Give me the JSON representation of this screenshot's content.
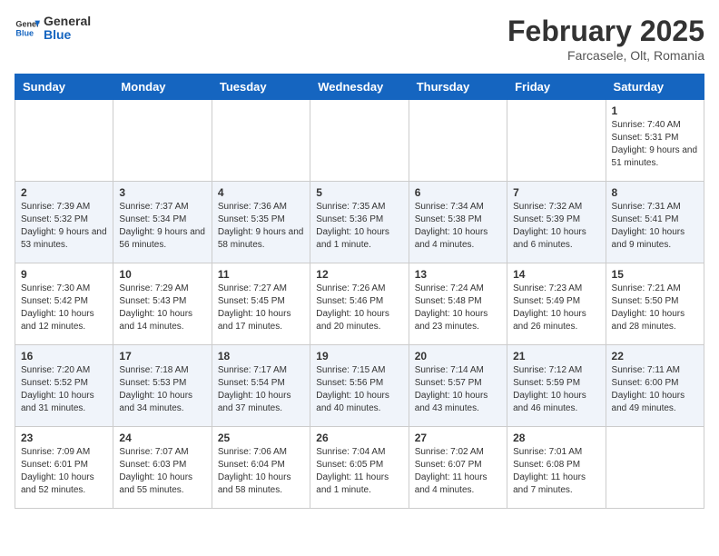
{
  "header": {
    "logo_line1": "General",
    "logo_line2": "Blue",
    "month": "February 2025",
    "location": "Farcasele, Olt, Romania"
  },
  "weekdays": [
    "Sunday",
    "Monday",
    "Tuesday",
    "Wednesday",
    "Thursday",
    "Friday",
    "Saturday"
  ],
  "weeks": [
    [
      {
        "day": "",
        "info": ""
      },
      {
        "day": "",
        "info": ""
      },
      {
        "day": "",
        "info": ""
      },
      {
        "day": "",
        "info": ""
      },
      {
        "day": "",
        "info": ""
      },
      {
        "day": "",
        "info": ""
      },
      {
        "day": "1",
        "info": "Sunrise: 7:40 AM\nSunset: 5:31 PM\nDaylight: 9 hours and 51 minutes."
      }
    ],
    [
      {
        "day": "2",
        "info": "Sunrise: 7:39 AM\nSunset: 5:32 PM\nDaylight: 9 hours and 53 minutes."
      },
      {
        "day": "3",
        "info": "Sunrise: 7:37 AM\nSunset: 5:34 PM\nDaylight: 9 hours and 56 minutes."
      },
      {
        "day": "4",
        "info": "Sunrise: 7:36 AM\nSunset: 5:35 PM\nDaylight: 9 hours and 58 minutes."
      },
      {
        "day": "5",
        "info": "Sunrise: 7:35 AM\nSunset: 5:36 PM\nDaylight: 10 hours and 1 minute."
      },
      {
        "day": "6",
        "info": "Sunrise: 7:34 AM\nSunset: 5:38 PM\nDaylight: 10 hours and 4 minutes."
      },
      {
        "day": "7",
        "info": "Sunrise: 7:32 AM\nSunset: 5:39 PM\nDaylight: 10 hours and 6 minutes."
      },
      {
        "day": "8",
        "info": "Sunrise: 7:31 AM\nSunset: 5:41 PM\nDaylight: 10 hours and 9 minutes."
      }
    ],
    [
      {
        "day": "9",
        "info": "Sunrise: 7:30 AM\nSunset: 5:42 PM\nDaylight: 10 hours and 12 minutes."
      },
      {
        "day": "10",
        "info": "Sunrise: 7:29 AM\nSunset: 5:43 PM\nDaylight: 10 hours and 14 minutes."
      },
      {
        "day": "11",
        "info": "Sunrise: 7:27 AM\nSunset: 5:45 PM\nDaylight: 10 hours and 17 minutes."
      },
      {
        "day": "12",
        "info": "Sunrise: 7:26 AM\nSunset: 5:46 PM\nDaylight: 10 hours and 20 minutes."
      },
      {
        "day": "13",
        "info": "Sunrise: 7:24 AM\nSunset: 5:48 PM\nDaylight: 10 hours and 23 minutes."
      },
      {
        "day": "14",
        "info": "Sunrise: 7:23 AM\nSunset: 5:49 PM\nDaylight: 10 hours and 26 minutes."
      },
      {
        "day": "15",
        "info": "Sunrise: 7:21 AM\nSunset: 5:50 PM\nDaylight: 10 hours and 28 minutes."
      }
    ],
    [
      {
        "day": "16",
        "info": "Sunrise: 7:20 AM\nSunset: 5:52 PM\nDaylight: 10 hours and 31 minutes."
      },
      {
        "day": "17",
        "info": "Sunrise: 7:18 AM\nSunset: 5:53 PM\nDaylight: 10 hours and 34 minutes."
      },
      {
        "day": "18",
        "info": "Sunrise: 7:17 AM\nSunset: 5:54 PM\nDaylight: 10 hours and 37 minutes."
      },
      {
        "day": "19",
        "info": "Sunrise: 7:15 AM\nSunset: 5:56 PM\nDaylight: 10 hours and 40 minutes."
      },
      {
        "day": "20",
        "info": "Sunrise: 7:14 AM\nSunset: 5:57 PM\nDaylight: 10 hours and 43 minutes."
      },
      {
        "day": "21",
        "info": "Sunrise: 7:12 AM\nSunset: 5:59 PM\nDaylight: 10 hours and 46 minutes."
      },
      {
        "day": "22",
        "info": "Sunrise: 7:11 AM\nSunset: 6:00 PM\nDaylight: 10 hours and 49 minutes."
      }
    ],
    [
      {
        "day": "23",
        "info": "Sunrise: 7:09 AM\nSunset: 6:01 PM\nDaylight: 10 hours and 52 minutes."
      },
      {
        "day": "24",
        "info": "Sunrise: 7:07 AM\nSunset: 6:03 PM\nDaylight: 10 hours and 55 minutes."
      },
      {
        "day": "25",
        "info": "Sunrise: 7:06 AM\nSunset: 6:04 PM\nDaylight: 10 hours and 58 minutes."
      },
      {
        "day": "26",
        "info": "Sunrise: 7:04 AM\nSunset: 6:05 PM\nDaylight: 11 hours and 1 minute."
      },
      {
        "day": "27",
        "info": "Sunrise: 7:02 AM\nSunset: 6:07 PM\nDaylight: 11 hours and 4 minutes."
      },
      {
        "day": "28",
        "info": "Sunrise: 7:01 AM\nSunset: 6:08 PM\nDaylight: 11 hours and 7 minutes."
      },
      {
        "day": "",
        "info": ""
      }
    ]
  ]
}
